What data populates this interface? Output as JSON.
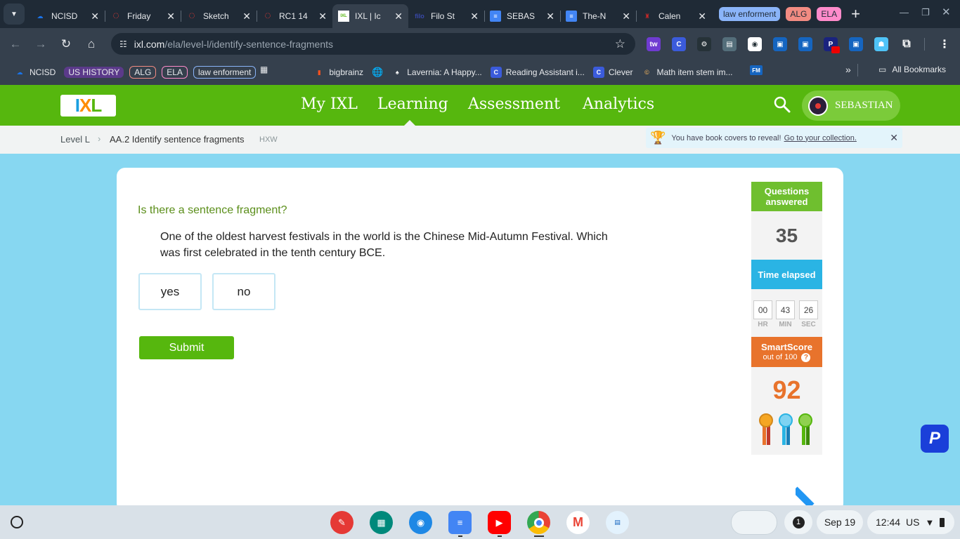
{
  "browser": {
    "tabs": [
      {
        "title": "NCISD",
        "favicon": "cloud-icon",
        "color": "#1a73e8"
      },
      {
        "title": "Friday",
        "favicon": "ring-icon",
        "color": "#e53935"
      },
      {
        "title": "Sketch",
        "favicon": "ring-icon",
        "color": "#e53935"
      },
      {
        "title": "RC1 14",
        "favicon": "ring-icon",
        "color": "#e53935"
      },
      {
        "title": "IXL | Ic",
        "favicon": "ixl-icon",
        "color": "#56b70e",
        "active": true
      },
      {
        "title": "Filo St",
        "favicon": "filo-icon",
        "color": "#3949ab"
      },
      {
        "title": "SEBAS",
        "favicon": "docs-icon",
        "color": "#4285f4"
      },
      {
        "title": "The-N",
        "favicon": "docs-icon",
        "color": "#4285f4"
      },
      {
        "title": "Calen",
        "favicon": "helmet-icon",
        "color": "#c62828"
      }
    ],
    "tab_groups": [
      {
        "label": "law enforment",
        "color": "#8ab4f8"
      },
      {
        "label": "ALG",
        "color": "#f28b82"
      },
      {
        "label": "ELA",
        "color": "#ff8bcb"
      }
    ],
    "address": {
      "host": "ixl.com",
      "path": "/ela/level-l/identify-sentence-fragments"
    },
    "bookmarks": [
      {
        "label": "NCISD",
        "icon": "cloud-icon"
      },
      {
        "label": "US HISTORY",
        "type": "group",
        "color": "#c58af9"
      },
      {
        "label": "ALG",
        "type": "group",
        "color": "#f28b82"
      },
      {
        "label": "ELA",
        "type": "group",
        "color": "#ff8bcb"
      },
      {
        "label": "law enforment",
        "type": "group",
        "color": "#8ab4f8"
      },
      {
        "label": "bigbrainz",
        "icon": "bigbrainz-icon"
      },
      {
        "label": "Lavernia: A Happy...",
        "icon": "lavernia-icon"
      },
      {
        "label": "Reading Assistant i...",
        "icon": "clever-icon"
      },
      {
        "label": "Clever",
        "icon": "clever-icon"
      },
      {
        "label": "Math item stem im...",
        "icon": "copyright-icon"
      }
    ],
    "all_bookmarks": "All Bookmarks",
    "overflow": "»"
  },
  "ixl": {
    "logo": "IXL",
    "nav": [
      "My IXL",
      "Learning",
      "Assessment",
      "Analytics"
    ],
    "active_nav": 1,
    "user": "SEBASTIAN",
    "breadcrumb": {
      "level": "Level L",
      "skill": "AA.2 Identify sentence fragments",
      "code": "HXW"
    },
    "notice": {
      "text": "You have book covers to reveal!",
      "link": "Go to your collection."
    },
    "question": {
      "prompt": "Is there a sentence fragment?",
      "passage_line1": "One of the oldest harvest festivals in the world is the Chinese Mid-Autumn Festival. Which",
      "passage_line2": "was first celebrated in the tenth century BCE.",
      "answers": [
        "yes",
        "no"
      ],
      "submit": "Submit"
    },
    "sidebar": {
      "questions_label": "Questions answered",
      "questions": "35",
      "time_label": "Time elapsed",
      "hr": "00",
      "min": "43",
      "sec": "26",
      "hr_label": "HR",
      "min_label": "MIN",
      "sec_label": "SEC",
      "smartscore_label": "SmartScore",
      "smartscore_sub": "out of 100",
      "smartscore": "92"
    },
    "colors": {
      "green": "#56b70e",
      "blue_bg": "#87d7f1",
      "orange": "#e8732c",
      "cyan": "#2ab4e4"
    }
  },
  "shelf": {
    "date": "Sep 19",
    "time": "12:44",
    "locale": "US",
    "notifications": "1"
  }
}
